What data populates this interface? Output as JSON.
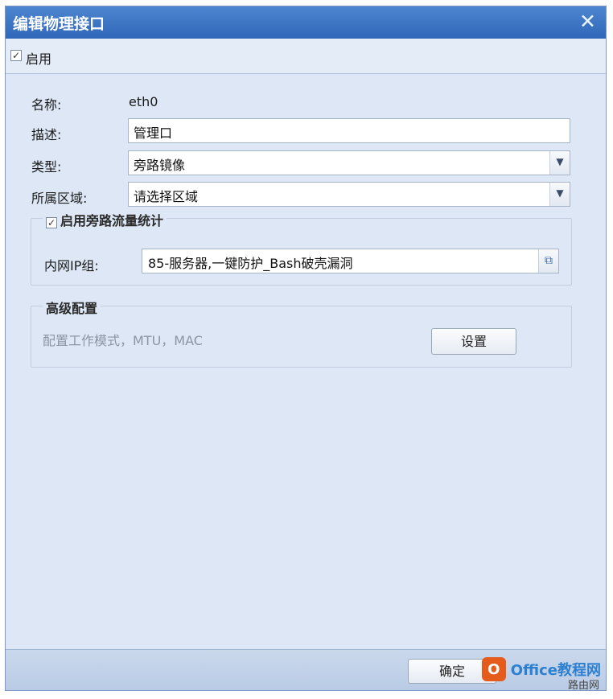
{
  "dialog": {
    "title": "编辑物理接口",
    "close_glyph": "✕"
  },
  "enable": {
    "checked_glyph": "✓",
    "label": "启用"
  },
  "form": {
    "name_label": "名称:",
    "name_value": "eth0",
    "desc_label": "描述:",
    "desc_value": "管理口",
    "type_label": "类型:",
    "type_value": "旁路镜像",
    "zone_label": "所属区域:",
    "zone_value": "请选择区域",
    "dropdown_glyph": "▼"
  },
  "bypass_stats": {
    "checked_glyph": "✓",
    "label": "启用旁路流量统计",
    "ip_group_label": "内网IP组:",
    "ip_group_value": "85-服务器,一键防护_Bash破壳漏洞",
    "picker_glyph": "⧉"
  },
  "advanced": {
    "legend": "高级配置",
    "desc": "配置工作模式，MTU，MAC",
    "settings_button": "设置"
  },
  "footer": {
    "ok_button": "确定",
    "watermark_logo": "O",
    "watermark_text": "Office教程网",
    "watermark_sub": "路由网"
  }
}
